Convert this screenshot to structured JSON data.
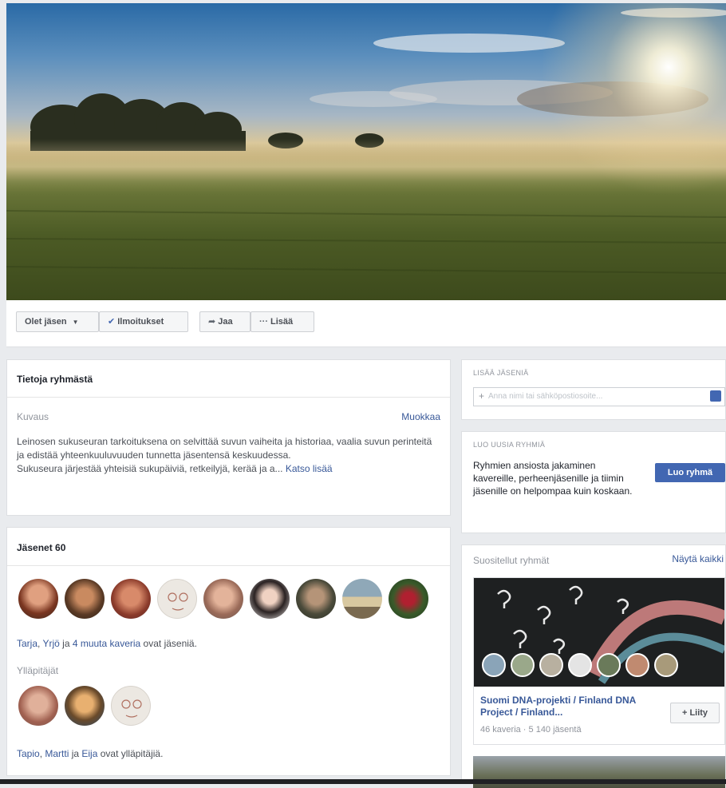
{
  "action_bar": {
    "member_label": "Olet jäsen",
    "notifications_label": "Ilmoitukset",
    "share_label": "Jaa",
    "more_label": "Lisää"
  },
  "about": {
    "title": "Tietoja ryhmästä",
    "description_label": "Kuvaus",
    "edit_label": "Muokkaa",
    "description_text": "Leinosen sukuseuran tarkoituksena on selvittää suvun vaiheita ja historiaa, vaalia suvun perinteitä ja edistää yhteenkuuluvuuden tunnetta jäsentensä keskuudessa.",
    "description_text_2": "Sukuseura järjestää yhteisiä sukupäiviä, retkeilyjä, kerää ja a...",
    "see_more_label": "Katso lisää"
  },
  "members": {
    "title": "Jäsenet 60",
    "friends_line": {
      "name1": "Tarja",
      "sep1": ", ",
      "name2": "Yrjö",
      "sep2": " ja ",
      "others": "4 muuta kaveria",
      "suffix": " ovat jäseniä."
    },
    "admins_label": "Ylläpitäjät",
    "admins_line": {
      "name1": "Tapio",
      "sep1": ", ",
      "name2": "Martti",
      "sep2": " ja ",
      "name3": "Eija",
      "suffix": " ovat ylläpitäjiä."
    }
  },
  "add_members": {
    "heading": "LISÄÄ JÄSENIÄ",
    "placeholder": "Anna nimi tai sähköpostiosoite..."
  },
  "create_group": {
    "heading": "LUO UUSIA RYHMIÄ",
    "text": "Ryhmien ansiosta jakaminen kavereille, perheenjäsenille ja tiimin jäsenille on helpompaa kuin koskaan.",
    "button_label": "Luo ryhmä"
  },
  "suggested": {
    "heading": "Suositellut ryhmät",
    "see_all_label": "Näytä kaikki",
    "group_name": "Suomi DNA-projekti / Finland DNA Project / Finland...",
    "group_meta": "46 kaveria · 5 140 jäsentä",
    "join_label": "Liity"
  },
  "colors": {
    "brand_blue": "#4267b2",
    "link_blue": "#385898",
    "page_bg": "#e9ebee"
  }
}
